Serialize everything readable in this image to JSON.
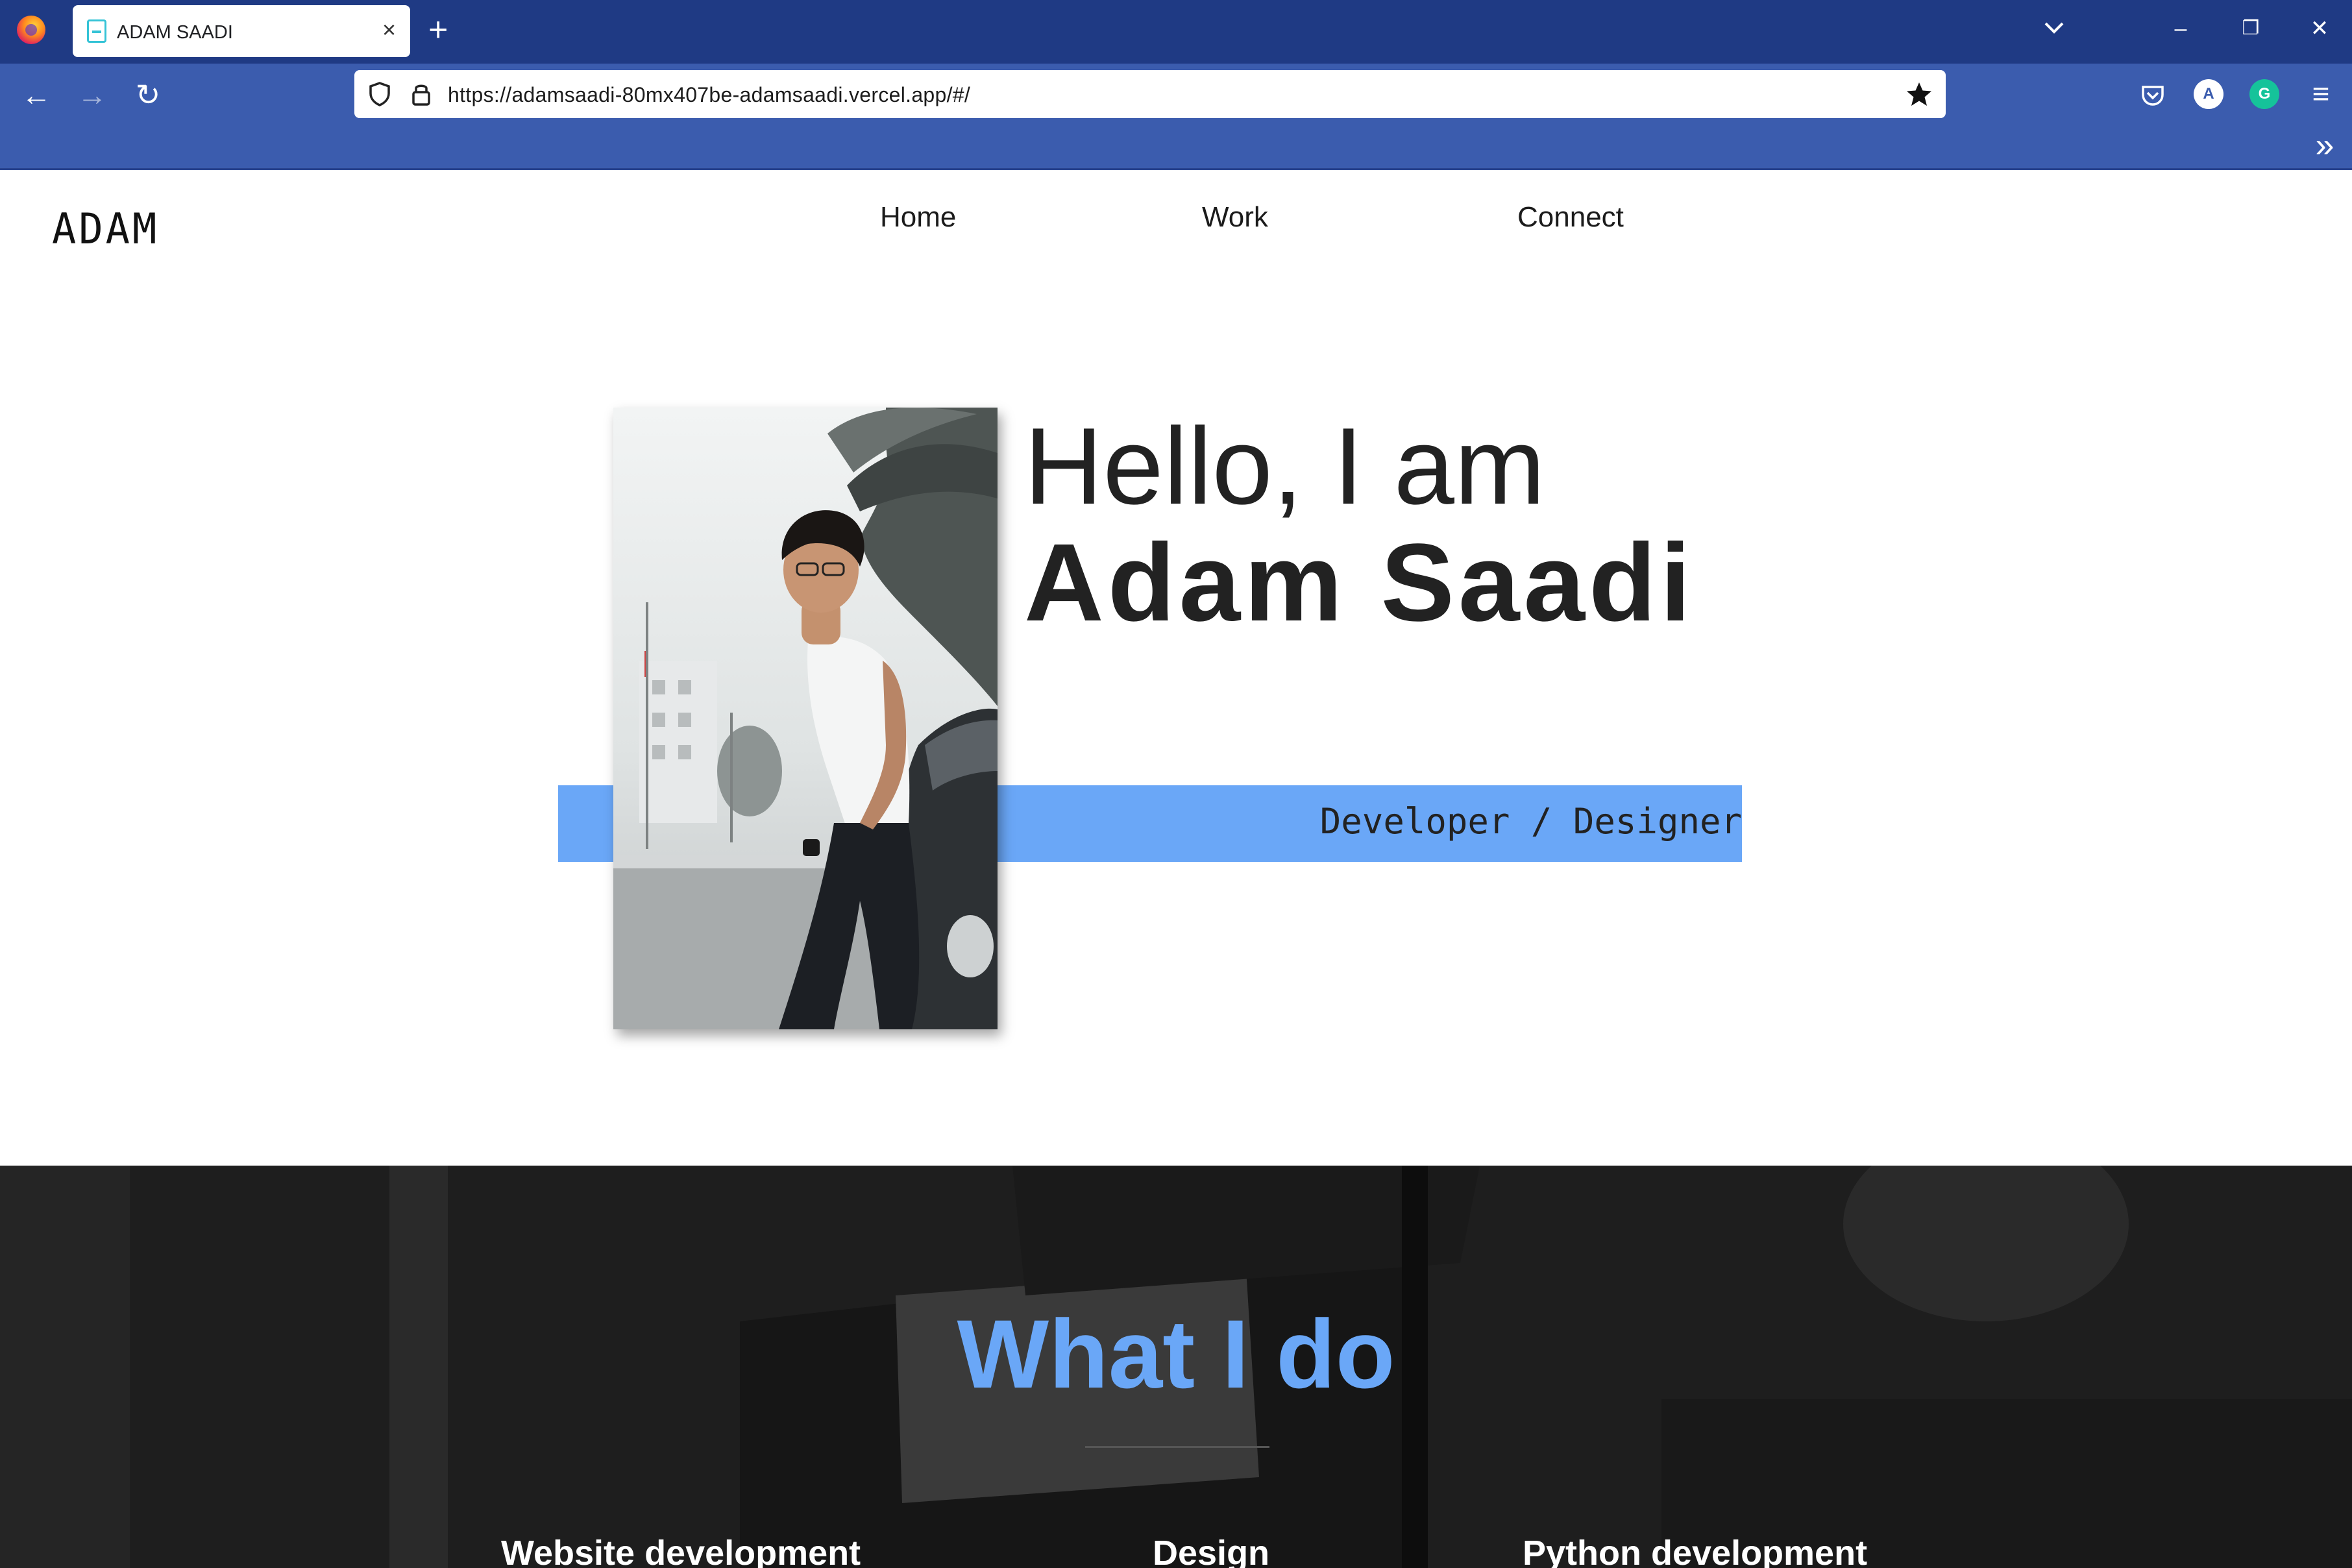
{
  "browser": {
    "tab_title": "ADAM SAADI",
    "tab_close": "×",
    "new_tab": "+",
    "url": "https://adamsaadi-80mx407be-adamsaadi.vercel.app/#/",
    "minimize": "–",
    "restore": "❐",
    "close": "✕",
    "back": "←",
    "forward": "→",
    "reload": "↻",
    "menu": "≡",
    "overflow": "»",
    "account_initial": "A",
    "grammarly_initial": "G"
  },
  "site": {
    "logo": "ADAM",
    "nav": [
      "Home",
      "Work",
      "Connect"
    ]
  },
  "hero": {
    "greeting": "Hello, I am",
    "name": "Adam Saadi",
    "role": "Developer / Designer"
  },
  "services": {
    "title": "What I do",
    "items": [
      "Website development",
      "Design",
      "Python development"
    ]
  },
  "colors": {
    "accent": "#6aa7f7",
    "browser_tabbar": "#1f3a84",
    "browser_toolbar": "#3b5cae",
    "dark_section": "#1e1e1e"
  }
}
